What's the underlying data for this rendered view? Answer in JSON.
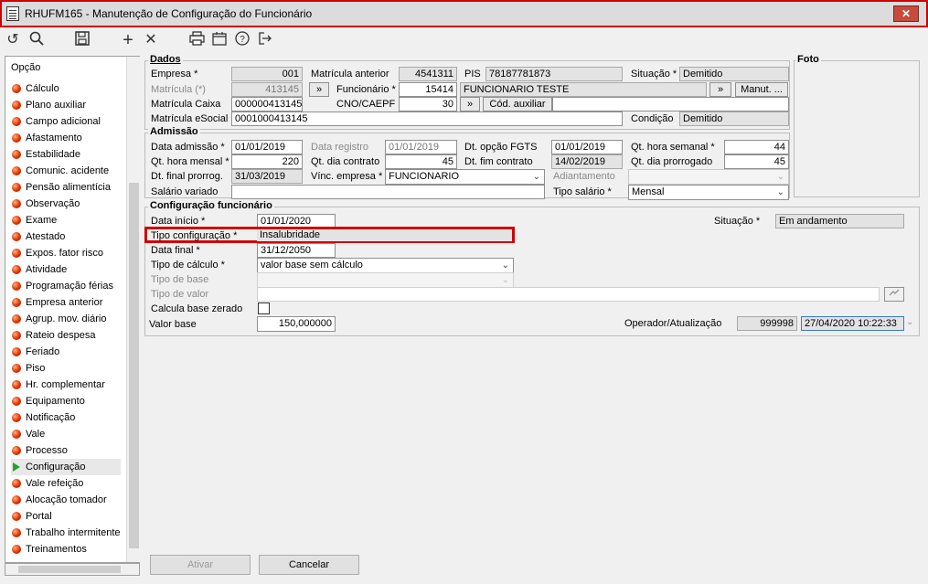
{
  "window": {
    "title": "RHUFM165 - Manutenção de Configuração do Funcionário",
    "close_label": "✕"
  },
  "toolbar": {
    "icons": [
      "refresh-icon",
      "search-icon",
      "save-icon",
      "add-icon",
      "delete-icon",
      "print-icon",
      "calendar-icon",
      "help-icon",
      "exit-icon"
    ],
    "glyphs": {
      "refresh": "↺",
      "search": "🔍",
      "save": "💾",
      "add": "+",
      "delete": "✕",
      "print": "🖶",
      "calendar": "📅",
      "help": "?",
      "exit": "⇥"
    }
  },
  "sidebar": {
    "header": "Opção",
    "items": [
      "Cálculo",
      "Plano auxiliar",
      "Campo adicional",
      "Afastamento",
      "Estabilidade",
      "Comunic. acidente",
      "Pensão alimentícia",
      "Observação",
      "Exame",
      "Atestado",
      "Expos. fator risco",
      "Atividade",
      "Programação férias",
      "Empresa anterior",
      "Agrup. mov. diário",
      "Rateio despesa",
      "Feriado",
      "Piso",
      "Hr. complementar",
      "Equipamento",
      "Notificação",
      "Vale",
      "Processo",
      "Configuração",
      "Vale refeição",
      "Alocação tomador",
      "Portal",
      "Trabalho intermitente",
      "Treinamentos"
    ],
    "active_index": 23
  },
  "dados": {
    "title": "Dados",
    "empresa_label": "Empresa *",
    "empresa": "001",
    "matricula_anterior_label": "Matrícula anterior",
    "matricula_anterior": "4541311",
    "pis_label": "PIS",
    "pis": "78187781873",
    "situacao_label": "Situação *",
    "situacao": "Demitido",
    "matricula_label": "Matrícula (*)",
    "matricula": "413145",
    "funcionario_label": "Funcionário *",
    "funcionario_code": "15414",
    "funcionario_name": "FUNCIONARIO TESTE",
    "manut_label": "Manut. ...",
    "matricula_caixa_label": "Matrícula Caixa",
    "matricula_caixa": "000000413145",
    "cno_label": "CNO/CAEPF",
    "cno": "30",
    "cod_auxiliar_label": "Cód. auxiliar",
    "matricula_esocial_label": "Matrícula eSocial",
    "matricula_esocial": "0001000413145",
    "condicao_label": "Condição",
    "condicao": "Demitido",
    "arrow": "»",
    "foto_label": "Foto"
  },
  "admissao": {
    "title": "Admissão",
    "data_admissao_label": "Data admissão *",
    "data_admissao": "01/01/2019",
    "data_registro_label": "Data registro",
    "data_registro": "01/01/2019",
    "dt_opcao_fgts_label": "Dt. opção FGTS",
    "dt_opcao_fgts": "01/01/2019",
    "qt_hora_semanal_label": "Qt. hora semanal *",
    "qt_hora_semanal": "44",
    "qt_hora_mensal_label": "Qt. hora mensal *",
    "qt_hora_mensal": "220",
    "qt_dia_contrato_label": "Qt. dia contrato",
    "qt_dia_contrato": "45",
    "dt_fim_contrato_label": "Dt. fim contrato",
    "dt_fim_contrato": "14/02/2019",
    "qt_dia_prorrogado_label": "Qt. dia prorrogado",
    "qt_dia_prorrogado": "45",
    "dt_final_prorrog_label": "Dt. final prorrog.",
    "dt_final_prorrog": "31/03/2019",
    "vinc_empresa_label": "Vínc. empresa *",
    "vinc_empresa": "FUNCIONARIO",
    "adiantamento_label": "Adiantamento",
    "salario_variado_label": "Salário variado",
    "tipo_salario_label": "Tipo salário *",
    "tipo_salario": "Mensal"
  },
  "config": {
    "title": "Configuração funcionário",
    "data_inicio_label": "Data início *",
    "data_inicio": "01/01/2020",
    "situacao_label": "Situação *",
    "situacao": "Em andamento",
    "tipo_configuracao_label": "Tipo configuração *",
    "tipo_configuracao": "Insalubridade",
    "data_final_label": "Data final *",
    "data_final": "31/12/2050",
    "tipo_calculo_label": "Tipo de cálculo *",
    "tipo_calculo": "valor base sem cálculo",
    "tipo_base_label": "Tipo de base",
    "tipo_valor_label": "Tipo de valor",
    "calcula_base_zerado_label": "Calcula base zerado",
    "valor_base_label": "Valor base",
    "valor_base": "150,000000",
    "operador_label": "Operador/Atualização",
    "operador": "999998",
    "atualizacao": "27/04/2020 10:22:33"
  },
  "buttons": {
    "ativar": "Ativar",
    "cancelar": "Cancelar"
  },
  "colors": {
    "highlight_border": "#d00000",
    "readonly_bg": "#e3e3e3"
  }
}
